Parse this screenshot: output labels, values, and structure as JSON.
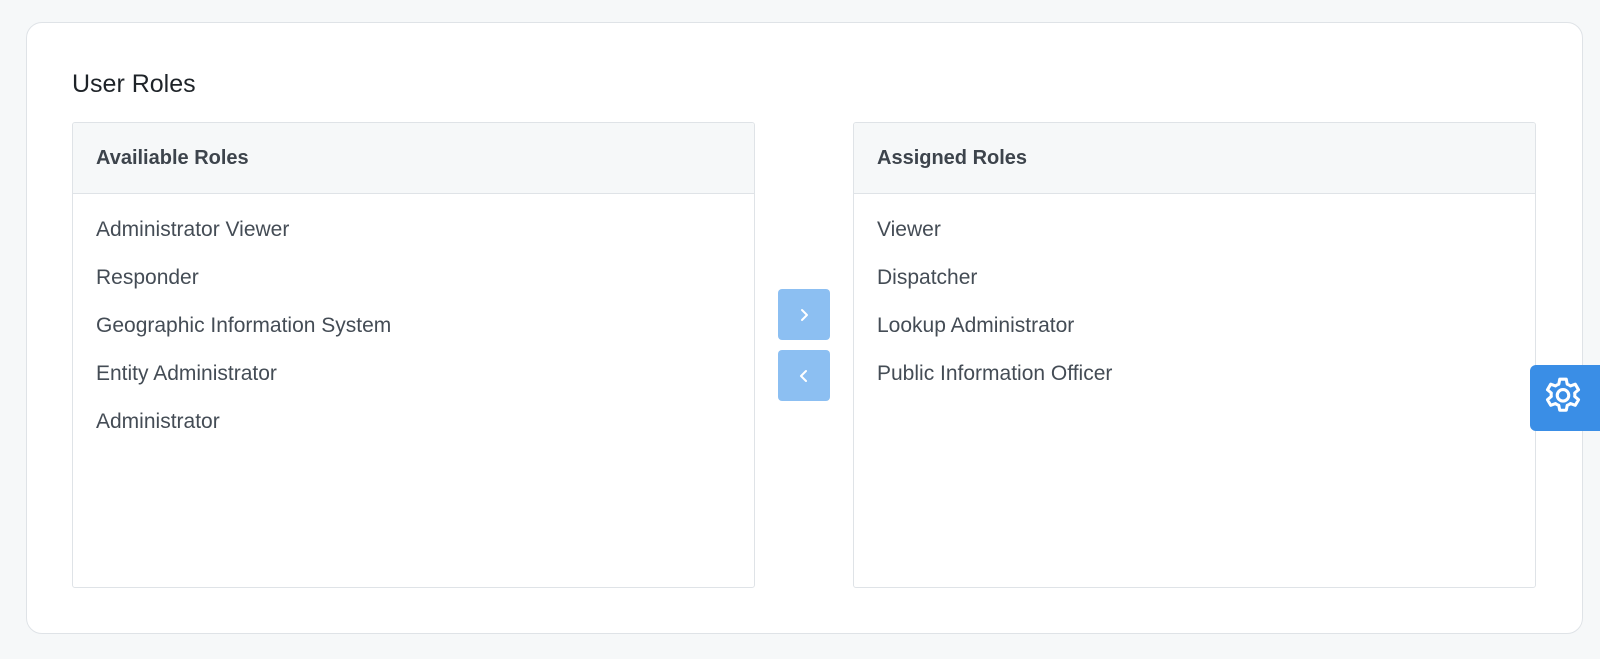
{
  "title": "User Roles",
  "available": {
    "header": "Availiable Roles",
    "items": [
      "Administrator Viewer",
      "Responder",
      "Geographic Information System",
      "Entity Administrator",
      "Administrator"
    ]
  },
  "assigned": {
    "header": "Assigned Roles",
    "items": [
      "Viewer",
      "Dispatcher",
      "Lookup Administrator",
      "Public Information Officer"
    ]
  },
  "controls": {
    "move_right_icon": "chevron-right-icon",
    "move_left_icon": "chevron-left-icon",
    "settings_icon": "gear-icon"
  },
  "colors": {
    "accent": "#3a8ee6",
    "transfer_button": "#8cbff2",
    "panel_header_bg": "#f6f8f9",
    "border": "#dfe3e7"
  }
}
